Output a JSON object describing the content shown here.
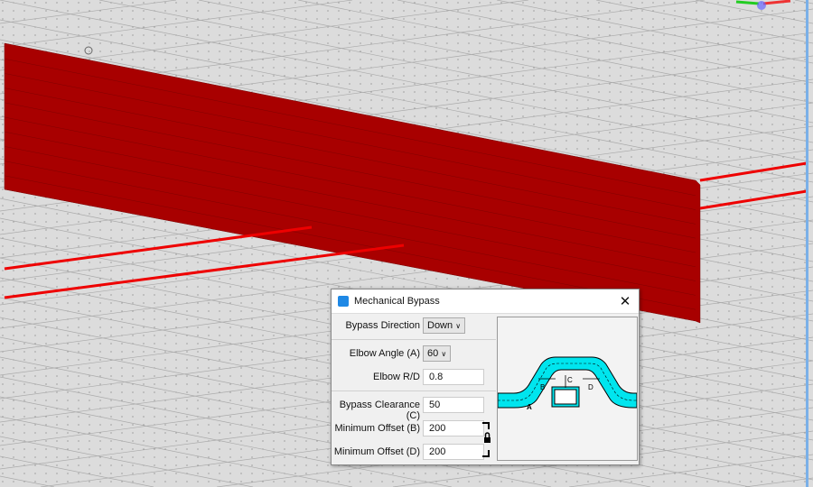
{
  "dialog": {
    "title": "Mechanical Bypass",
    "close_icon": "close-icon",
    "fields": {
      "bypass_direction": {
        "label": "Bypass Direction",
        "value": "Down"
      },
      "elbow_angle": {
        "label": "Elbow Angle (A)",
        "value": "60"
      },
      "elbow_rd": {
        "label": "Elbow R/D",
        "value": "0.8"
      },
      "bypass_clearance": {
        "label": "Bypass Clearance (C)",
        "value": "50"
      },
      "min_offset_b": {
        "label": "Minimum Offset (B)",
        "value": "200"
      },
      "min_offset_d": {
        "label": "Minimum Offset (D)",
        "value": "200"
      }
    },
    "diagram_labels": {
      "a": "A",
      "b": "B",
      "c": "C",
      "d": "D"
    }
  },
  "colors": {
    "beam": "#a00000",
    "duct": "#00e5ee",
    "background": "#dcdcdc"
  }
}
